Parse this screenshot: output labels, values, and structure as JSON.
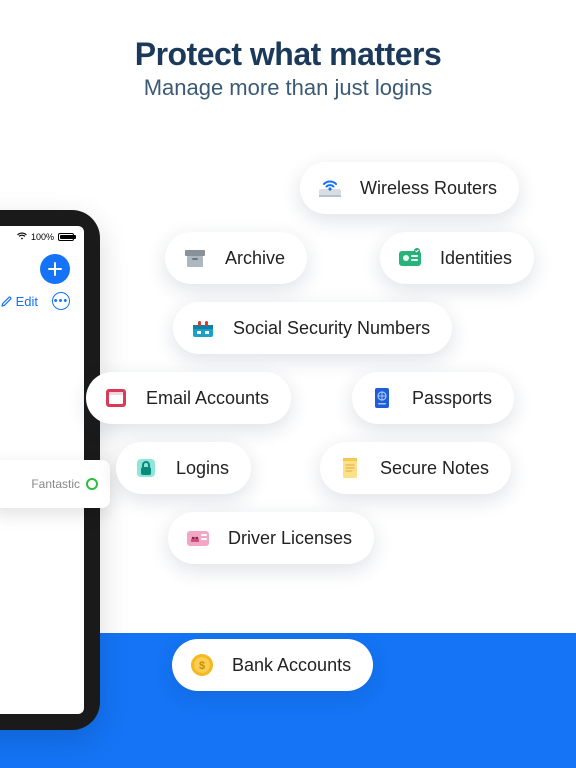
{
  "header": {
    "title": "Protect what matters",
    "subtitle": "Manage more than just logins"
  },
  "device": {
    "battery_text": "100%",
    "edit_label": "Edit"
  },
  "card": {
    "label": "Fantastic"
  },
  "pills": {
    "wireless_routers": "Wireless Routers",
    "archive": "Archive",
    "identities": "Identities",
    "ssn": "Social Security Numbers",
    "email": "Email Accounts",
    "passports": "Passports",
    "logins": "Logins",
    "secure_notes": "Secure Notes",
    "driver_licenses": "Driver Licenses",
    "bank_accounts": "Bank Accounts"
  }
}
